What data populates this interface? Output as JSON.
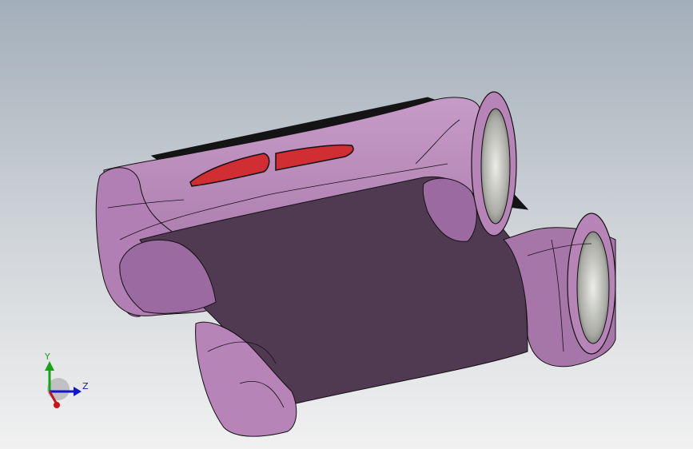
{
  "viewport": {
    "background_top": "#a2aeba",
    "background_bottom": "#f1f1f1"
  },
  "model": {
    "body_color": "#b684b6",
    "body_shadow_color": "#7d5a82",
    "bottom_face_color": "#4f3a51",
    "edge_color": "#161116",
    "tail_light_color": "#d12e33",
    "bore_color": "#c9cac4",
    "top_strip_color": "#141414"
  },
  "triad": {
    "y_label": "Y",
    "z_label": "Z",
    "y_color": "#19a319",
    "z_color": "#1414c8",
    "x_color": "#c81414"
  }
}
